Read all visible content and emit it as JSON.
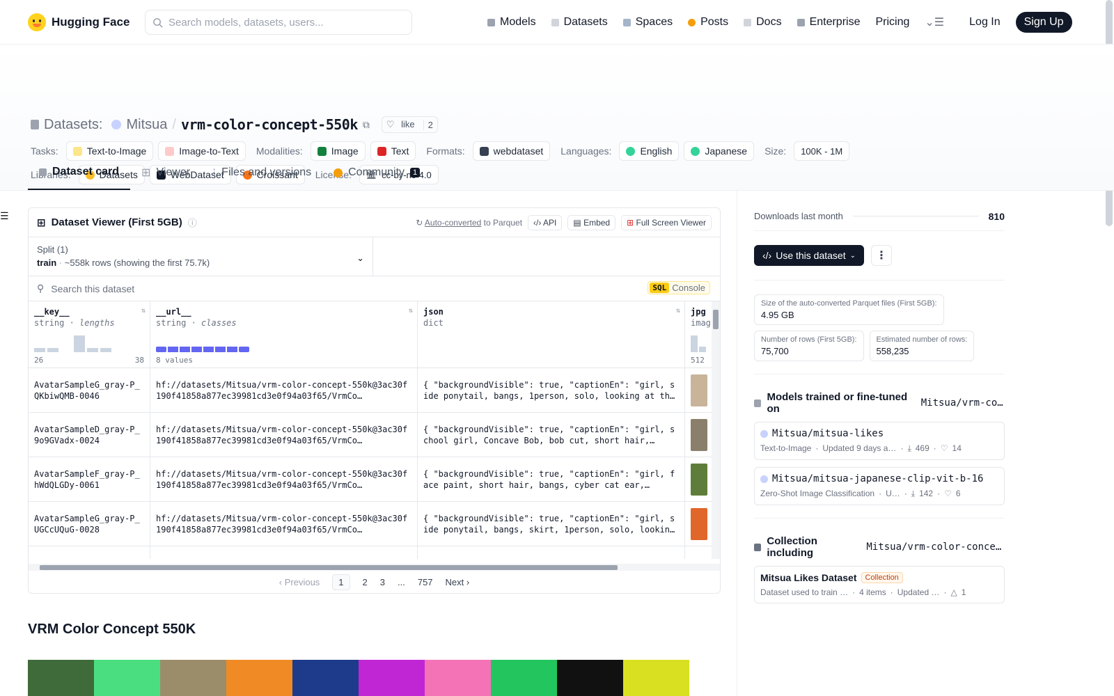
{
  "nav": {
    "brand": "Hugging Face",
    "search_placeholder": "Search models, datasets, users...",
    "links": [
      "Models",
      "Datasets",
      "Spaces",
      "Posts",
      "Docs",
      "Enterprise",
      "Pricing"
    ],
    "login": "Log In",
    "signup": "Sign Up"
  },
  "header": {
    "section": "Datasets:",
    "owner": "Mitsua",
    "sep": "/",
    "name": "vrm-color-concept-550k",
    "like": "like",
    "likes": "2"
  },
  "tags": {
    "tasks_label": "Tasks:",
    "tasks": [
      "Text-to-Image",
      "Image-to-Text"
    ],
    "modalities_label": "Modalities:",
    "modalities": [
      "Image",
      "Text"
    ],
    "formats_label": "Formats:",
    "formats": [
      "webdataset"
    ],
    "languages_label": "Languages:",
    "languages": [
      "English",
      "Japanese"
    ],
    "size_label": "Size:",
    "size": "100K - 1M",
    "libraries_label": "Libraries:",
    "libraries": [
      "Datasets",
      "WebDataset",
      "Croissant"
    ],
    "license_label": "License:",
    "license": "cc-by-nc-4.0"
  },
  "tabs": {
    "card": "Dataset card",
    "viewer": "Viewer",
    "files": "Files and versions",
    "community": "Community",
    "community_count": "1"
  },
  "viewer": {
    "title": "Dataset Viewer (First 5GB)",
    "auto": "Auto-converted",
    "to": "to Parquet",
    "api": "API",
    "embed": "Embed",
    "full": "Full Screen Viewer",
    "split_label": "Split (1)",
    "split_name": "train",
    "split_rows": "~558k rows (showing the first 75.7k)",
    "search_placeholder": "Search this dataset",
    "sql": "SQL",
    "console": "Console",
    "cols": [
      {
        "name": "__key__",
        "type": "string",
        "stat": "lengths",
        "min": "26",
        "max": "38"
      },
      {
        "name": "__url__",
        "type": "string",
        "stat": "classes",
        "range": "8 values"
      },
      {
        "name": "json",
        "type": "dict"
      },
      {
        "name": "jpg",
        "type": "imag",
        "min": "512"
      }
    ],
    "rows": [
      {
        "key": "AvatarSampleG_gray-P_QKbiwQMB-0046",
        "url": "hf://datasets/Mitsua/vrm-color-concept-550k@3ac30f190f41858a877ec39981cd3e0f94a03f65/VrmCo…",
        "json": "{ \"backgroundVisible\": true, \"captionEn\": \"girl, side ponytail, bangs, 1person, solo, looking at the…",
        "thumb": "#c9b49a"
      },
      {
        "key": "AvatarSampleD_gray-P_9o9GVadx-0024",
        "url": "hf://datasets/Mitsua/vrm-color-concept-550k@3ac30f190f41858a877ec39981cd3e0f94a03f65/VrmCo…",
        "json": "{ \"backgroundVisible\": true, \"captionEn\": \"girl, school girl, Concave Bob, bob cut, short hair,…",
        "thumb": "#8a7f6a"
      },
      {
        "key": "AvatarSampleF_gray-P_hWdQLGDy-0061",
        "url": "hf://datasets/Mitsua/vrm-color-concept-550k@3ac30f190f41858a877ec39981cd3e0f94a03f65/VrmCo…",
        "json": "{ \"backgroundVisible\": true, \"captionEn\": \"girl, face paint, short hair, bangs, cyber cat ear,…",
        "thumb": "#5f7d3a"
      },
      {
        "key": "AvatarSampleG_gray-P_UGCcUQuG-0028",
        "url": "hf://datasets/Mitsua/vrm-color-concept-550k@3ac30f190f41858a877ec39981cd3e0f94a03f65/VrmCo…",
        "json": "{ \"backgroundVisible\": true, \"captionEn\": \"girl, side ponytail, bangs, skirt, 1person, solo, looking…",
        "thumb": "#e0662a"
      }
    ],
    "pager": [
      "Previous",
      "1",
      "2",
      "3",
      "...",
      "757",
      "Next"
    ]
  },
  "readme_title": "VRM Color Concept 550K",
  "side": {
    "downloads_label": "Downloads last month",
    "downloads": "810",
    "use": "Use this dataset",
    "stats": [
      {
        "l": "Size of the auto-converted Parquet files (First 5GB):",
        "v": "4.95 GB"
      },
      {
        "l": "Number of rows (First 5GB):",
        "v": "75,700"
      },
      {
        "l": "Estimated number of rows:",
        "v": "558,235"
      }
    ],
    "models_title": "Models trained or fine-tuned on",
    "models_ref": "Mitsua/vrm-col…",
    "models": [
      {
        "name": "Mitsua/mitsua-likes",
        "task": "Text-to-Image",
        "updated": "Updated 9 days a…",
        "dl": "469",
        "likes": "14"
      },
      {
        "name": "Mitsua/mitsua-japanese-clip-vit-b-16",
        "task": "Zero-Shot Image Classification",
        "updated": "U…",
        "dl": "142",
        "likes": "6"
      }
    ],
    "coll_title": "Collection including",
    "coll_ref": "Mitsua/vrm-color-concept…",
    "coll": {
      "name": "Mitsua Likes Dataset",
      "badge": "Collection",
      "desc": "Dataset used to train …",
      "items": "4 items",
      "updated": "Updated …",
      "up": "1"
    }
  },
  "colors": {
    "accent": "#111827",
    "hist": "#6366f1"
  }
}
